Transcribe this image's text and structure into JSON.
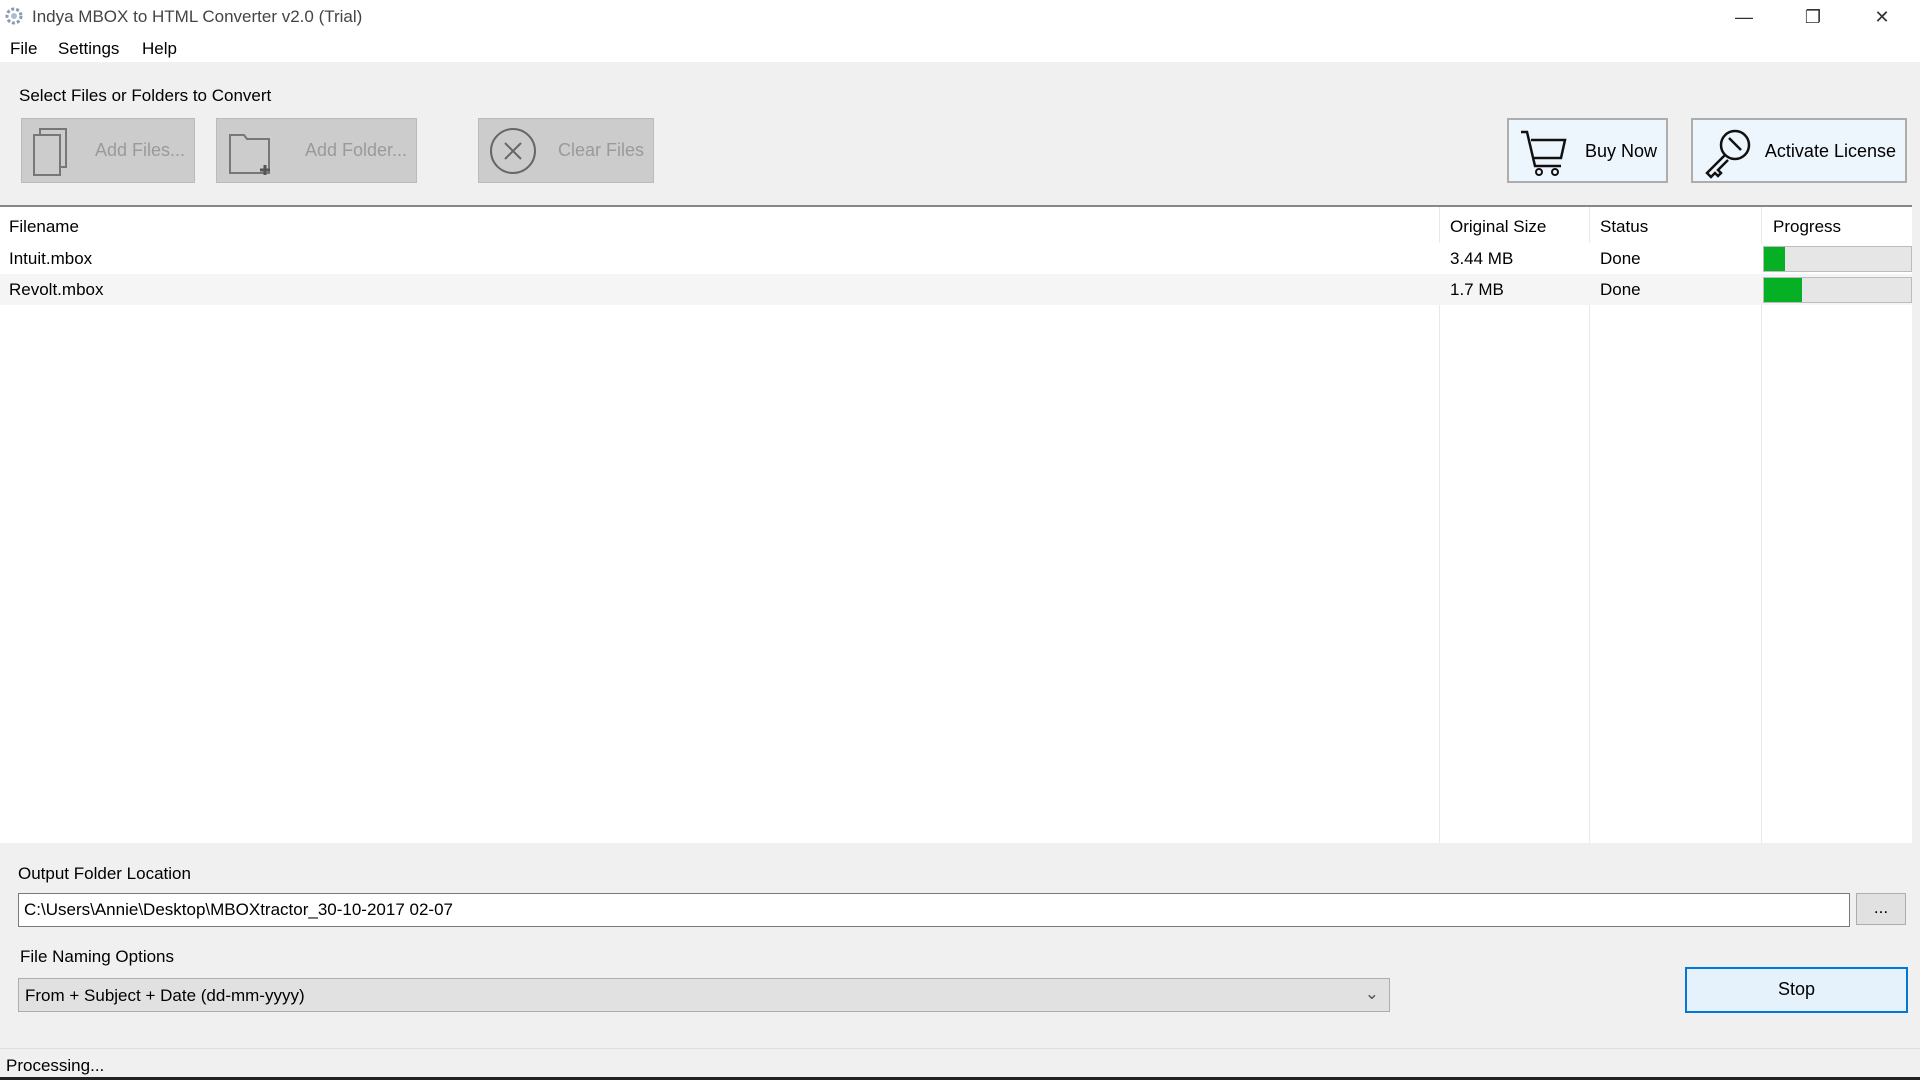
{
  "window": {
    "title": "Indya MBOX to HTML Converter v2.0 (Trial)"
  },
  "menu": [
    "File",
    "Settings",
    "Help"
  ],
  "toolbar": {
    "section_label": "Select Files or Folders to Convert",
    "add_files": "Add Files...",
    "add_folder": "Add Folder...",
    "clear_files": "Clear Files",
    "buy_now": "Buy Now",
    "activate_license": "Activate License"
  },
  "table": {
    "columns": [
      "Filename",
      "Original Size",
      "Status",
      "Progress"
    ],
    "rows": [
      {
        "filename": "Intuit.mbox",
        "size": "3.44 MB",
        "status": "Done",
        "progress": 14
      },
      {
        "filename": "Revolt.mbox",
        "size": "1.7 MB",
        "status": "Done",
        "progress": 26
      }
    ]
  },
  "output": {
    "label": "Output Folder Location",
    "value": "C:\\Users\\Annie\\Desktop\\MBOXtractor_30-10-2017 02-07",
    "browse": "..."
  },
  "naming": {
    "label": "File Naming Options",
    "value": "From + Subject + Date (dd-mm-yyyy)"
  },
  "stop_label": "Stop",
  "status_text": "Processing...",
  "colors": {
    "progress": "#06b025",
    "button_accent": "#0078d7"
  }
}
